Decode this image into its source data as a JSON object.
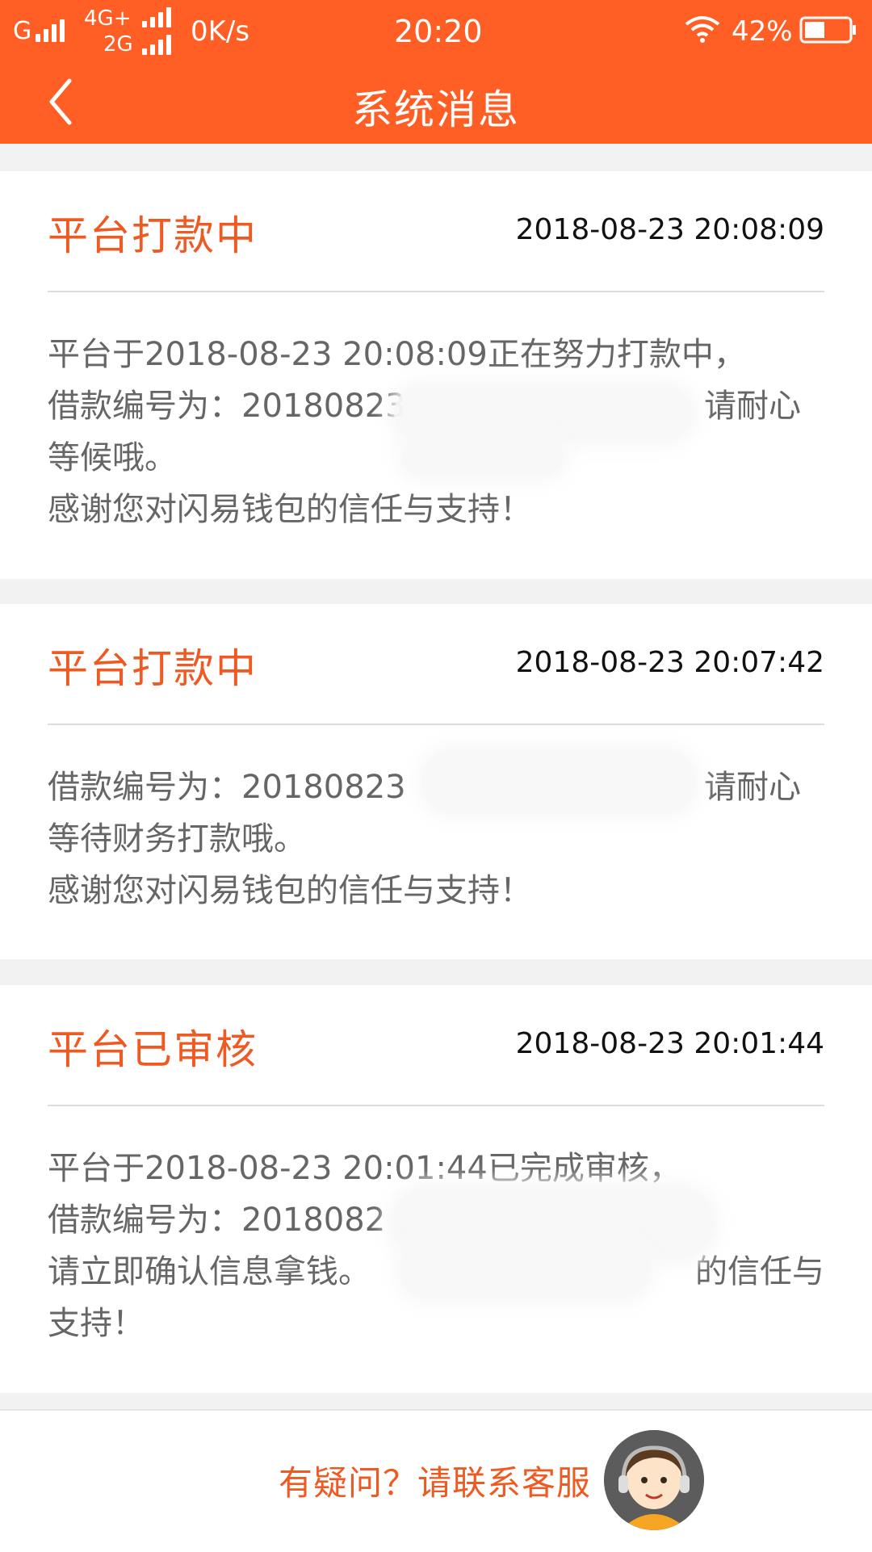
{
  "status_bar": {
    "network_g": "G",
    "network_4g": "4G+",
    "network_2g": "2G",
    "speed": "0K/s",
    "time": "20:20",
    "battery": "42%"
  },
  "header": {
    "title": "系统消息"
  },
  "messages": [
    {
      "title": "平台打款中",
      "time": "2018-08-23 20:08:09",
      "lines": [
        "平台于2018-08-23 20:08:09正在努力打款中，",
        "借款编号为：20180823",
        "等候哦。",
        "感谢您对闪易钱包的信任与支持！"
      ],
      "line2_suffix": "请耐心"
    },
    {
      "title": "平台打款中",
      "time": "2018-08-23 20:07:42",
      "lines": [
        "借款编号为：20180823",
        "等待财务打款哦。",
        "感谢您对闪易钱包的信任与支持！"
      ],
      "line1_suffix": "请耐心"
    },
    {
      "title": "平台已审核",
      "time": "2018-08-23 20:01:44",
      "lines": [
        "平台于2018-08-23 20:01:44已完成审核，",
        "借款编号为：2018082",
        "请立即确认信息拿钱。",
        "支持！"
      ],
      "line3_suffix": "的信任与"
    }
  ],
  "footer": {
    "contact_label": "有疑问？请联系客服"
  },
  "colors": {
    "brand": "#ff5e24",
    "title_orange": "#ee5a22"
  },
  "icons": {
    "back": "chevron-left-icon",
    "wifi": "wifi-icon",
    "battery": "battery-icon",
    "avatar": "customer-service-avatar"
  }
}
